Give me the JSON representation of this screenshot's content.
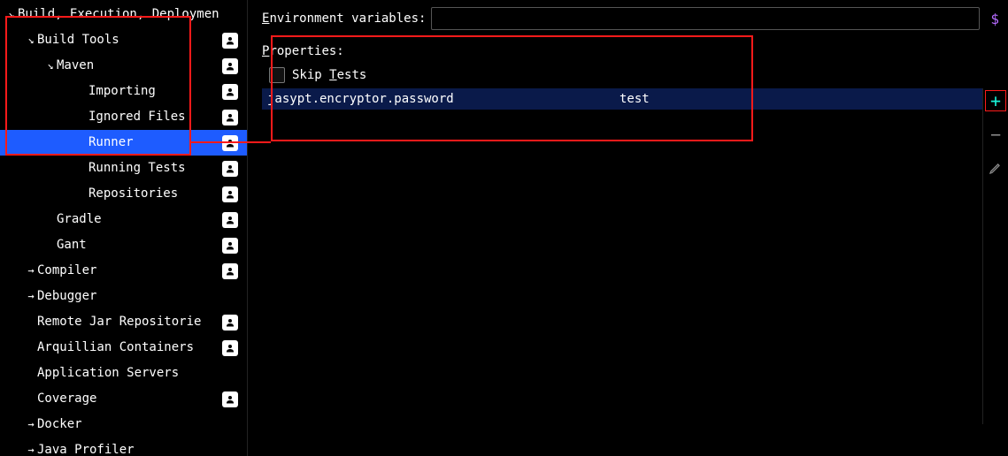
{
  "sidebar": {
    "items": [
      {
        "label": "Build, Execution, Deploymen",
        "depth": 0,
        "arrow": "↘",
        "badge": false,
        "selected": false
      },
      {
        "label": "Build Tools",
        "depth": 1,
        "arrow": "↘",
        "badge": true,
        "selected": false
      },
      {
        "label": "Maven",
        "depth": 2,
        "arrow": "↘",
        "badge": true,
        "selected": false
      },
      {
        "label": "Importing",
        "depth": 3,
        "arrow": "",
        "badge": true,
        "selected": false
      },
      {
        "label": "Ignored Files",
        "depth": 3,
        "arrow": "",
        "badge": true,
        "selected": false
      },
      {
        "label": "Runner",
        "depth": 3,
        "arrow": "",
        "badge": true,
        "selected": true
      },
      {
        "label": "Running Tests",
        "depth": 3,
        "arrow": "",
        "badge": true,
        "selected": false
      },
      {
        "label": "Repositories",
        "depth": 3,
        "arrow": "",
        "badge": true,
        "selected": false
      },
      {
        "label": "Gradle",
        "depth": 2,
        "arrow": "",
        "badge": true,
        "selected": false
      },
      {
        "label": "Gant",
        "depth": 2,
        "arrow": "",
        "badge": true,
        "selected": false
      },
      {
        "label": "Compiler",
        "depth": 1,
        "arrow": "→",
        "badge": true,
        "selected": false
      },
      {
        "label": "Debugger",
        "depth": 1,
        "arrow": "→",
        "badge": false,
        "selected": false
      },
      {
        "label": "Remote Jar Repositorie",
        "depth": 1,
        "arrow": "",
        "badge": true,
        "selected": false
      },
      {
        "label": "Arquillian Containers",
        "depth": 1,
        "arrow": "",
        "badge": true,
        "selected": false
      },
      {
        "label": "Application Servers",
        "depth": 1,
        "arrow": "",
        "badge": false,
        "selected": false
      },
      {
        "label": "Coverage",
        "depth": 1,
        "arrow": "",
        "badge": true,
        "selected": false
      },
      {
        "label": "Docker",
        "depth": 1,
        "arrow": "→",
        "badge": false,
        "selected": false
      },
      {
        "label": "Java Profiler",
        "depth": 1,
        "arrow": "→",
        "badge": false,
        "selected": false
      }
    ]
  },
  "main": {
    "env_label_pre": "E",
    "env_label_post": "nvironment variables:",
    "env_value": "",
    "dollar": "$",
    "props_label_pre": "P",
    "props_label_post": "roperties:",
    "skip_pre": "Skip ",
    "skip_mn": "T",
    "skip_post": "ests",
    "row": {
      "key": "jasypt.encryptor.password",
      "value": "test"
    },
    "btn_plus": "+",
    "btn_minus": "−"
  }
}
